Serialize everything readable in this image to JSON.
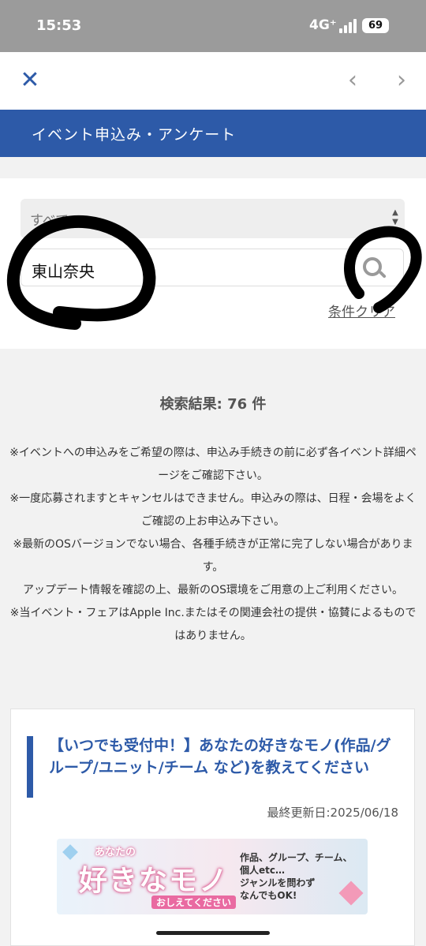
{
  "status_bar": {
    "time": "15:53",
    "network": "4G⁺",
    "battery": "69"
  },
  "nav": {
    "close_icon": "close-icon",
    "back_icon": "chevron-left-icon",
    "forward_icon": "chevron-right-icon"
  },
  "header": {
    "title": "イベント申込み・アンケート"
  },
  "search": {
    "category_value": "すべて",
    "keyword_value": "東山奈央",
    "clear_label": "条件クリア"
  },
  "results": {
    "count_label": "検索結果: 76 件",
    "notes": [
      "※イベントへの申込みをご希望の際は、申込み手続きの前に必ず各イベント詳細ページをご確認下さい。",
      "※一度応募されますとキャンセルはできません。申込みの際は、日程・会場をよくご確認の上お申込み下さい。",
      "※最新のOSバージョンでない場合、各種手続きが正常に完了しない場合があります。",
      "アップデート情報を確認の上、最新のOS環境をご用意の上ご利用ください。",
      "※当イベント・フェアはApple Inc.またはその関連会社の提供・協賛によるものではありません。"
    ]
  },
  "card": {
    "title": "【いつでも受付中！】あなたの好きなモノ(作品/グループ/ユニット/チーム など)を教えてください",
    "updated": "最終更新日:2025/06/18",
    "banner": {
      "small": "あなたの",
      "big": "好きなモノ",
      "sub": "おしえてください",
      "desc": "作品、グループ、チーム、\n個人etc…\nジャンルを問わず\nなんでもOK!"
    }
  },
  "colors": {
    "brand": "#2d5aa8",
    "status_bar": "#9b9b9b"
  }
}
